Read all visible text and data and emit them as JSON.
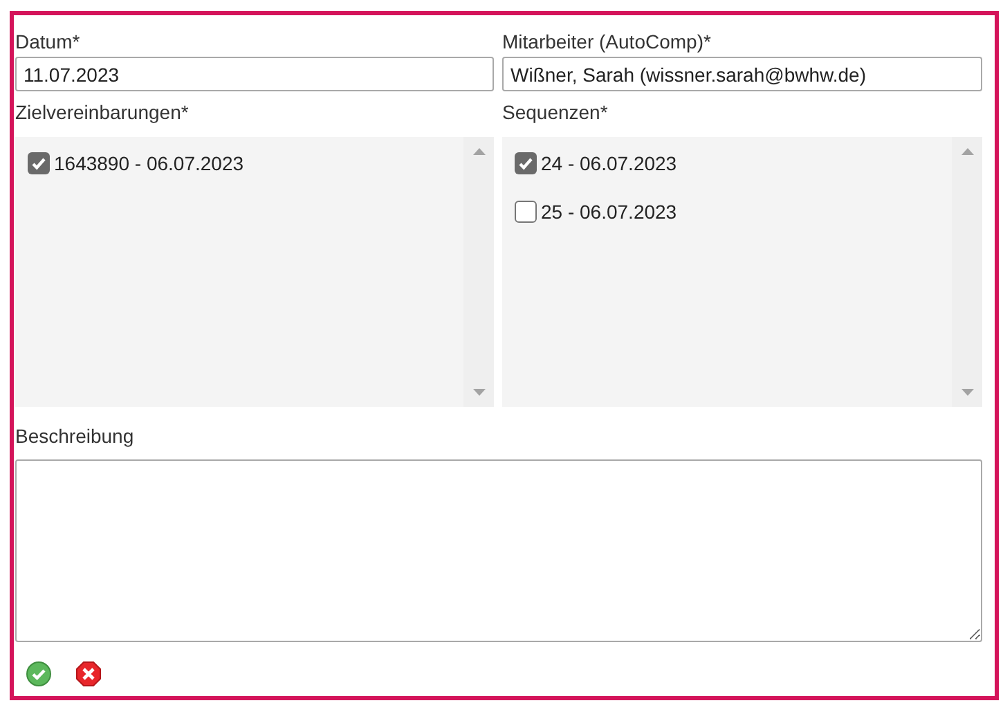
{
  "fields": [
    {
      "label": "Datum*",
      "value": "11.07.2023"
    },
    {
      "label": "Mitarbeiter (AutoComp)*",
      "value": "Wißner, Sarah (wissner.sarah@bwhw.de)"
    }
  ],
  "lists": [
    {
      "label": "Zielvereinbarungen*",
      "items": [
        {
          "text": "1643890 - 06.07.2023",
          "checked": true
        }
      ]
    },
    {
      "label": "Sequenzen*",
      "items": [
        {
          "text": "24 - 06.07.2023",
          "checked": true
        },
        {
          "text": "25 - 06.07.2023",
          "checked": false
        }
      ]
    }
  ],
  "description": {
    "label": "Beschreibung"
  },
  "actions": [
    {
      "kind": "confirm"
    },
    {
      "kind": "cancel"
    }
  ]
}
